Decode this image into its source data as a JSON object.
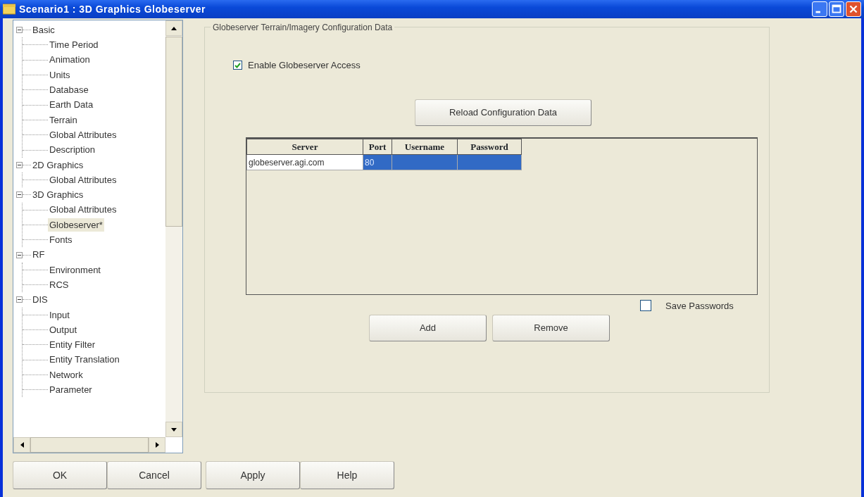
{
  "window": {
    "title": "Scenario1 : 3D Graphics Globeserver"
  },
  "tree": {
    "items": [
      {
        "label": "Basic",
        "expanded": true,
        "selected": false,
        "children": [
          {
            "label": "Time Period",
            "selected": false
          },
          {
            "label": "Animation",
            "selected": false
          },
          {
            "label": "Units",
            "selected": false
          },
          {
            "label": "Database",
            "selected": false
          },
          {
            "label": "Earth Data",
            "selected": false
          },
          {
            "label": "Terrain",
            "selected": false
          },
          {
            "label": "Global Attributes",
            "selected": false
          },
          {
            "label": "Description",
            "selected": false
          }
        ]
      },
      {
        "label": "2D Graphics",
        "expanded": true,
        "selected": false,
        "children": [
          {
            "label": "Global Attributes",
            "selected": false
          }
        ]
      },
      {
        "label": "3D Graphics",
        "expanded": true,
        "selected": false,
        "children": [
          {
            "label": "Global Attributes",
            "selected": false
          },
          {
            "label": "Globeserver*",
            "selected": true
          },
          {
            "label": "Fonts",
            "selected": false
          }
        ]
      },
      {
        "label": "RF",
        "expanded": true,
        "selected": false,
        "children": [
          {
            "label": "Environment",
            "selected": false
          },
          {
            "label": "RCS",
            "selected": false
          }
        ]
      },
      {
        "label": "DIS",
        "expanded": true,
        "selected": false,
        "children": [
          {
            "label": "Input",
            "selected": false
          },
          {
            "label": "Output",
            "selected": false
          },
          {
            "label": "Entity Filter",
            "selected": false
          },
          {
            "label": "Entity Translation",
            "selected": false
          },
          {
            "label": "Network",
            "selected": false
          },
          {
            "label": "Parameter",
            "selected": false
          }
        ]
      }
    ]
  },
  "group": {
    "title": "Globeserver Terrain/Imagery Configuration Data",
    "enable_checkbox": {
      "label": "Enable Globeserver Access",
      "checked": true
    },
    "reload_button": "Reload Configuration Data",
    "table": {
      "columns": [
        "Server",
        "Port",
        "Username",
        "Password"
      ],
      "rows": [
        {
          "cells": [
            "globeserver.agi.com",
            "80",
            "",
            ""
          ],
          "selected": true
        }
      ]
    },
    "save_passwords": {
      "label": "Save Passwords",
      "checked": false
    },
    "buttons": [
      "Add",
      "Remove"
    ]
  },
  "footer_buttons": [
    "OK",
    "Cancel",
    "Apply",
    "Help"
  ]
}
